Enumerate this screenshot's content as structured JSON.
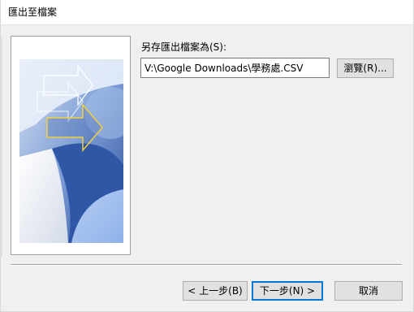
{
  "window": {
    "title": "匯出至檔案"
  },
  "form": {
    "save_label": "另存匯出檔案為(S):",
    "path_value": "V:\\Google Downloads\\學務處.CSV",
    "browse_label": "瀏覽(R)..."
  },
  "buttons": {
    "back_label": "< 上一步(B)",
    "next_label": "下一步(N) >",
    "cancel_label": "取消"
  },
  "colors": {
    "focus_border": "#0078d7",
    "art_blue_dark": "#2a4f9c",
    "art_blue_light": "#8fb2ea",
    "art_arrow_yellow": "#f0d040"
  },
  "icons": {
    "wizard_art": "export-wizard-graphic"
  }
}
